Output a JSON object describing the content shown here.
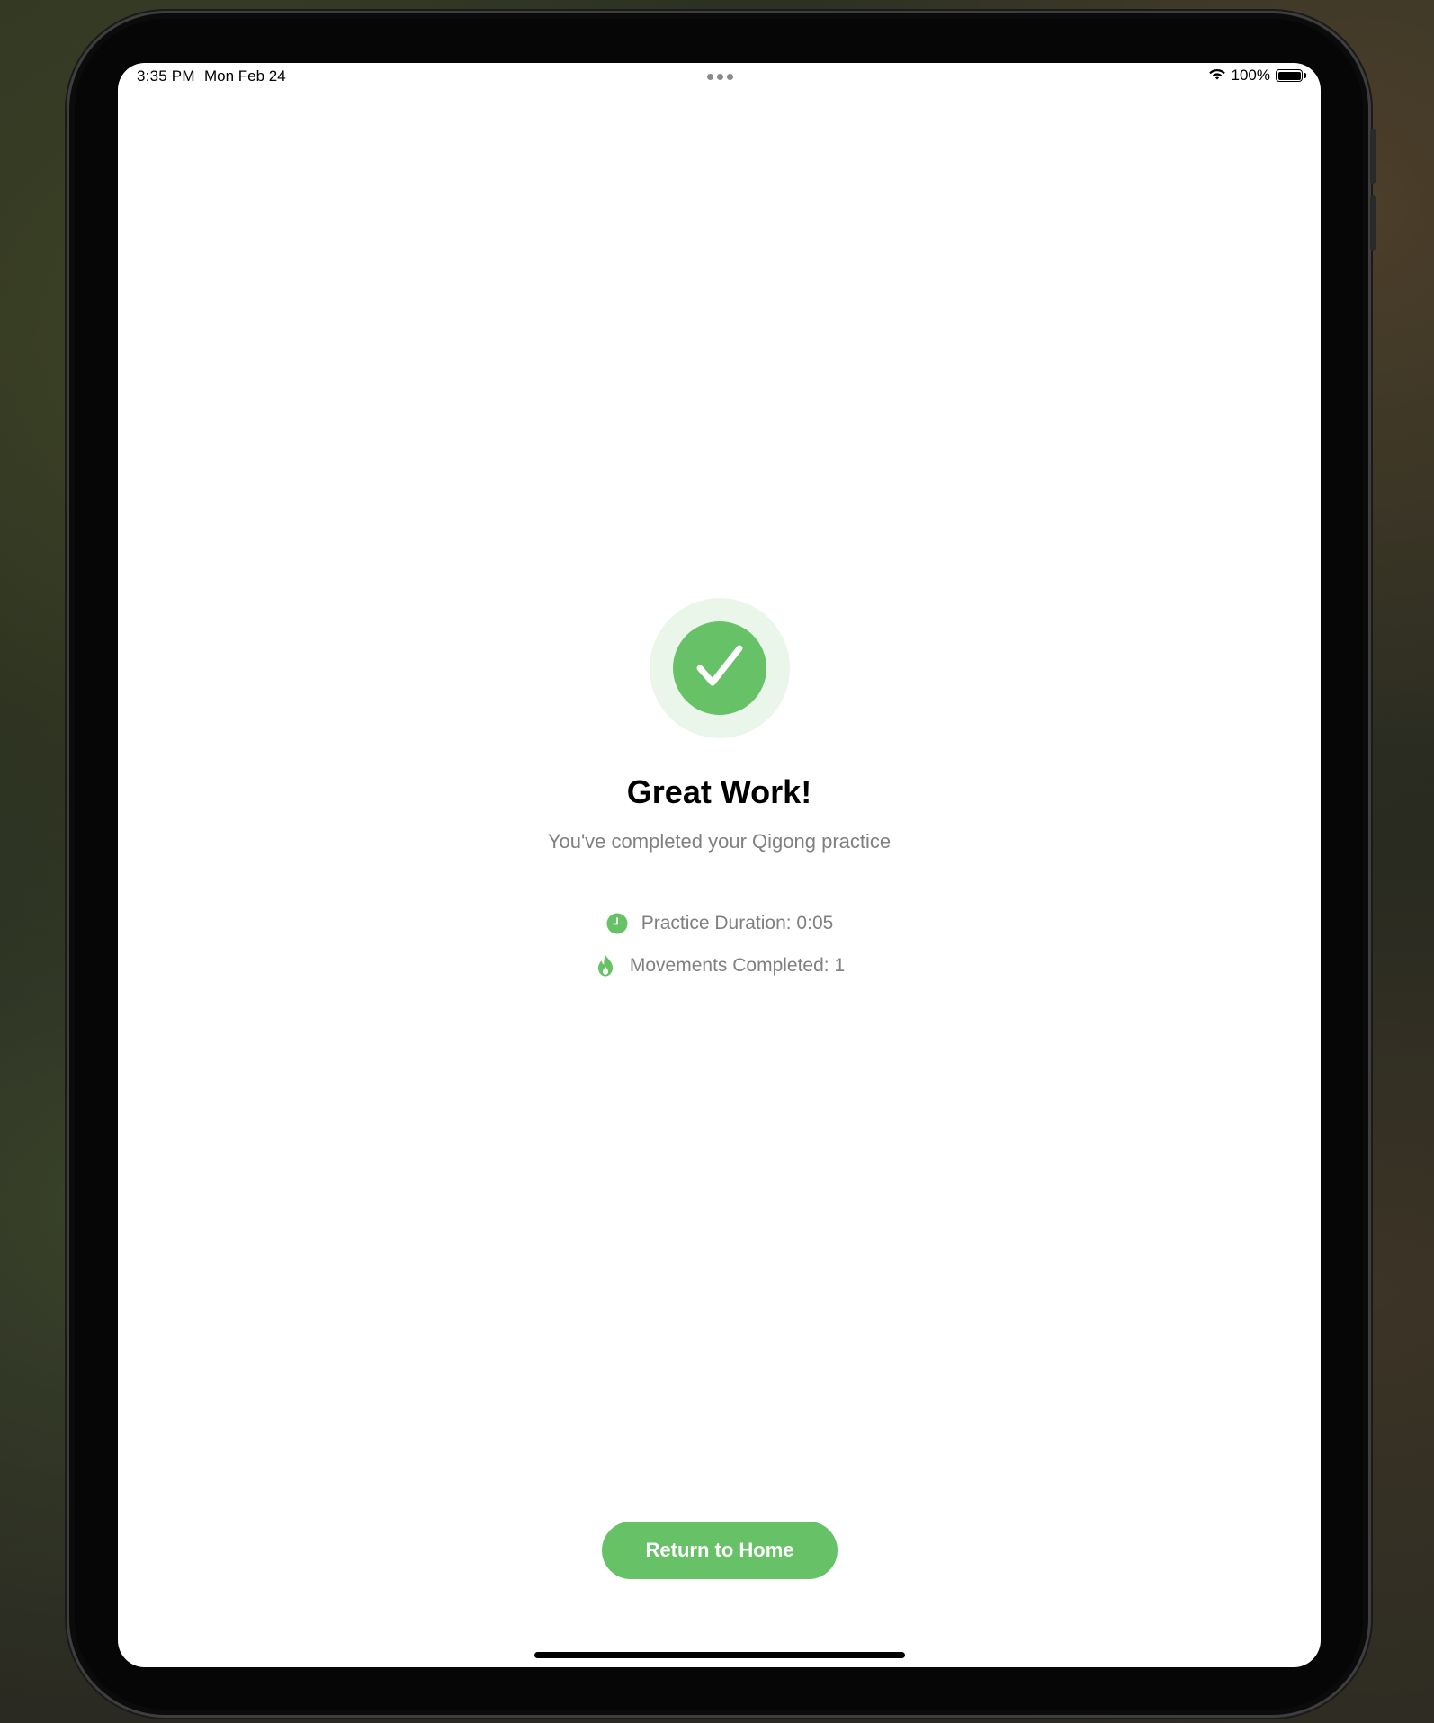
{
  "status_bar": {
    "time": "3:35 PM",
    "date": "Mon Feb 24",
    "battery": "100%",
    "battery_level": 1.0,
    "icons": [
      "wifi-icon",
      "battery-icon",
      "multitasking-dots-icon"
    ]
  },
  "completion": {
    "icon": "checkmark-icon",
    "title": "Great Work!",
    "subtitle": "You've completed your Qigong practice"
  },
  "stats": [
    {
      "icon": "clock-icon",
      "text": "Practice Duration: 0:05"
    },
    {
      "icon": "flame-icon",
      "text": "Movements Completed: 1"
    }
  ],
  "actions": {
    "return_home_label": "Return to Home"
  },
  "colors": {
    "accent": "#67c167",
    "accent_light": "#eaf6ea",
    "secondary_text": "#808080"
  }
}
